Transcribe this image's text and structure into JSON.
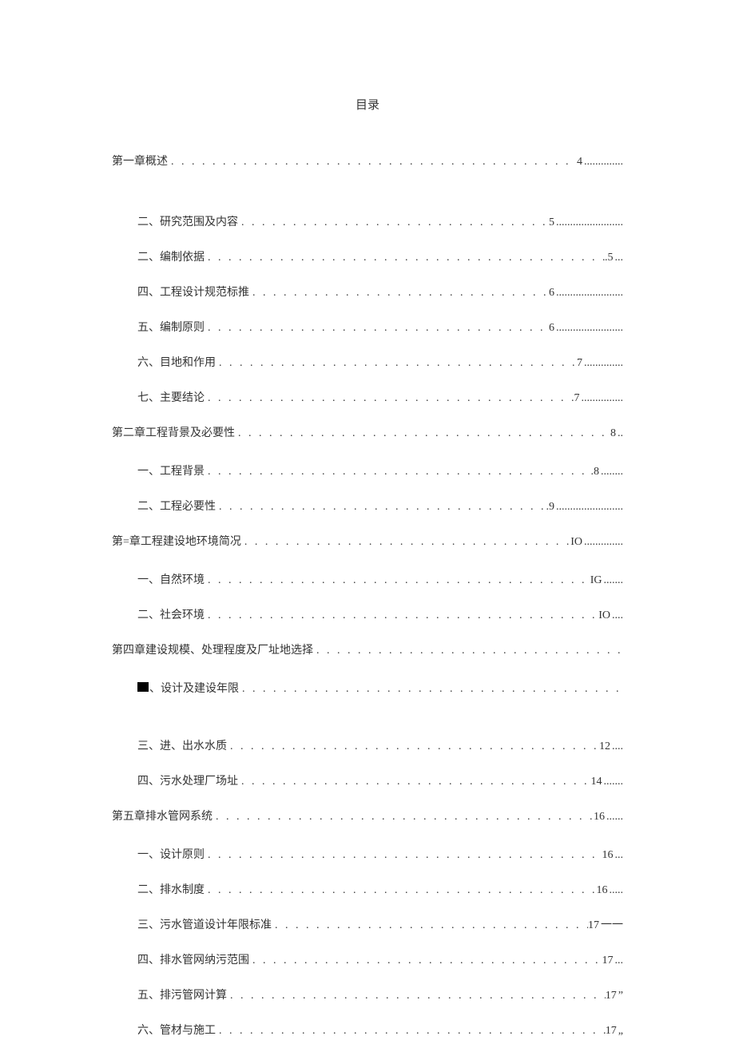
{
  "title": "目录",
  "entries": [
    {
      "level": 0,
      "text": "第一章概述",
      "page": "4",
      "trail": ".............."
    },
    {
      "level": 1,
      "text": "二、研究范围及内容",
      "page": "5",
      "trail": "........................",
      "pregap": true
    },
    {
      "level": 1,
      "text": "二、编制依据",
      "page": ".5",
      "trail": "..."
    },
    {
      "level": 1,
      "text": "四、工程设计规范标推",
      "page": "6",
      "trail": "........................"
    },
    {
      "level": 1,
      "text": "五、编制原则",
      "page": "6",
      "trail": "........................"
    },
    {
      "level": 1,
      "text": "六、目地和作用",
      "page": "7",
      "trail": ".............."
    },
    {
      "level": 1,
      "text": "七、主要结论",
      "page": ".7",
      "trail": " ..............."
    },
    {
      "level": 0,
      "text": "第二章工程背景及必要性",
      "page": "8",
      "trail": ".."
    },
    {
      "level": 1,
      "text": "一、工程背景",
      "page": ".8",
      "trail": " ........"
    },
    {
      "level": 1,
      "text": "二、工程必要性",
      "page": ".9",
      "trail": " ........................"
    },
    {
      "level": 0,
      "text": "第=章工程建设地环境简况",
      "page": "IO",
      "trail": " .............."
    },
    {
      "level": 1,
      "text": "一、自然环境",
      "page": "IG",
      "trail": " ......."
    },
    {
      "level": 1,
      "text": "二、社会环境",
      "page": "IO",
      "trail": "...."
    },
    {
      "level": 0,
      "text": "第四章建设规模、处理程度及厂址地选择",
      "page": "",
      "trail": ""
    },
    {
      "level": 1,
      "box": true,
      "text": "、设计及建设年限",
      "page": "",
      "trail": ""
    },
    {
      "level": 1,
      "text": "三、进、出水水质",
      "page": "12",
      "trail": "....",
      "pregap": true
    },
    {
      "level": 1,
      "text": "四、污水处理厂场址",
      "page": "14",
      "trail": "......."
    },
    {
      "level": 0,
      "text": "第五章排水管网系统",
      "page": "16",
      "trail": "......"
    },
    {
      "level": 1,
      "text": "一、设计原则",
      "page": "16",
      "trail": "..."
    },
    {
      "level": 1,
      "text": "二、排水制度",
      "page": "16",
      "trail": "....."
    },
    {
      "level": 1,
      "text": "三、污水管道设计年限标准",
      "page": "17",
      "trail": " 一一"
    },
    {
      "level": 1,
      "text": "四、排水管网纳污范围",
      "page": "17",
      "trail": "..."
    },
    {
      "level": 1,
      "text": "五、排污管网计算",
      "page": "17",
      "trail": "”"
    },
    {
      "level": 1,
      "text": "六、管材与施工",
      "page": "17",
      "trail": "„"
    }
  ]
}
